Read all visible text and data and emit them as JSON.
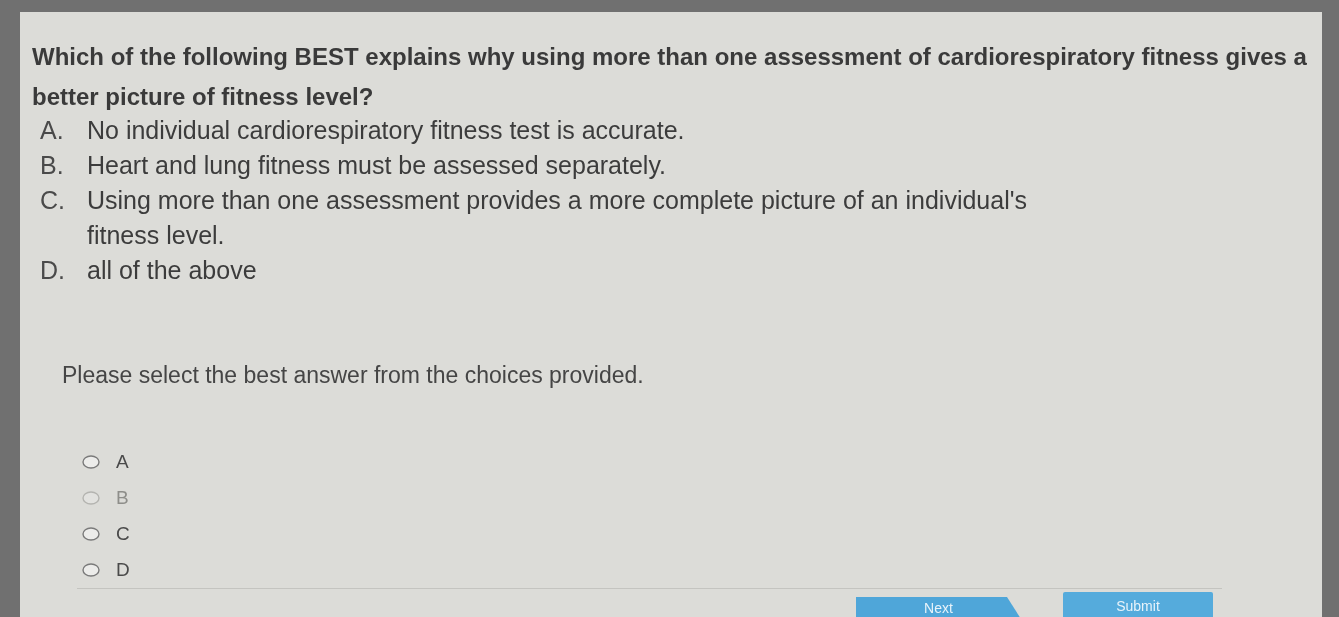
{
  "question": {
    "text": "Which of the following BEST explains why using more than one assessment of cardiorespiratory fitness gives a better picture of fitness level?",
    "options": [
      {
        "letter": "A.",
        "text": "No individual cardiorespiratory fitness test is accurate."
      },
      {
        "letter": "B.",
        "text": "Heart and lung fitness must be assessed separately."
      },
      {
        "letter": "C.",
        "text": "Using more than one assessment provides a more complete picture of an individual's fitness level."
      },
      {
        "letter": "D.",
        "text": "all of the above"
      }
    ]
  },
  "instruction": "Please select the best answer from the choices provided.",
  "choices": [
    {
      "label": "A",
      "selected": false,
      "disabled": false
    },
    {
      "label": "B",
      "selected": false,
      "disabled": true
    },
    {
      "label": "C",
      "selected": false,
      "disabled": false
    },
    {
      "label": "D",
      "selected": false,
      "disabled": false
    }
  ],
  "buttons": [
    {
      "label": "Next",
      "kind": "next"
    },
    {
      "label": "Submit",
      "kind": "submit"
    }
  ]
}
